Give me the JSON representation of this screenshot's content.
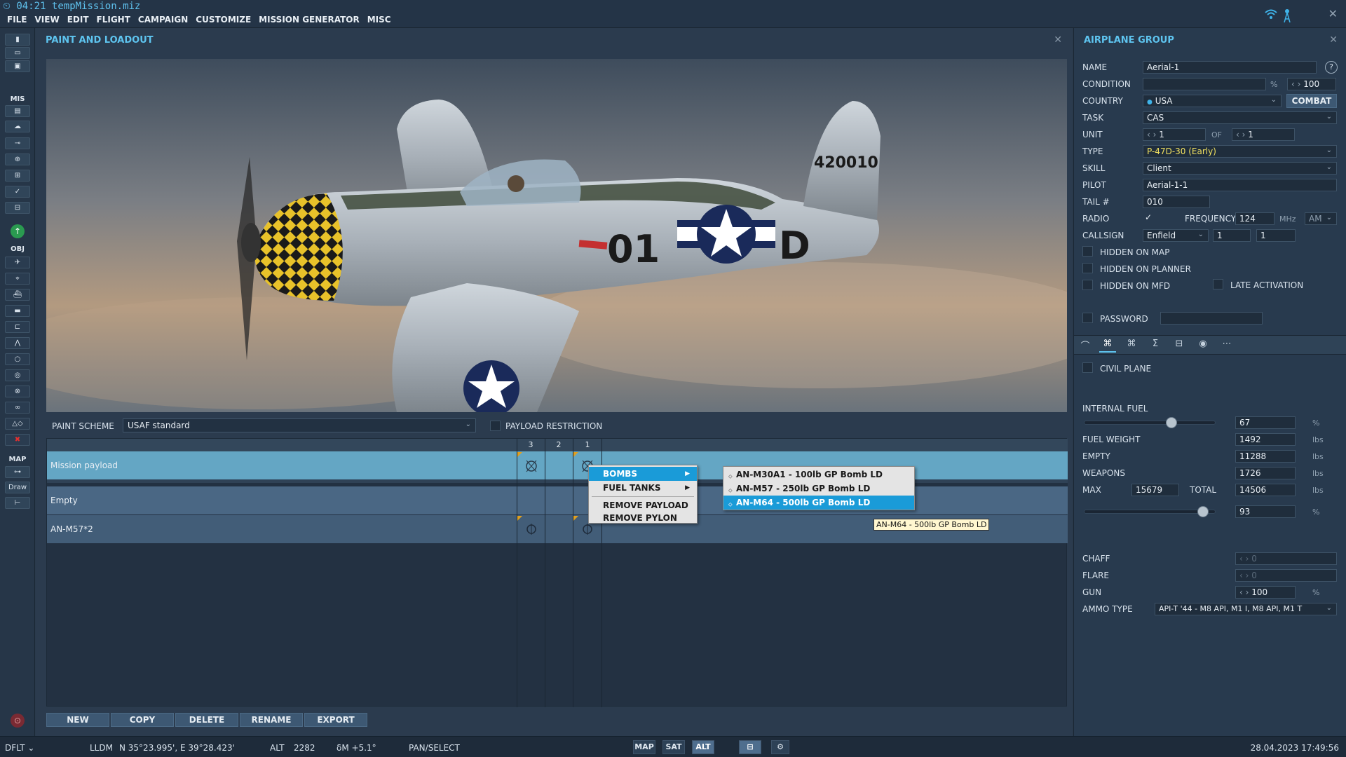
{
  "window": {
    "title": "04:21 tempMission.miz"
  },
  "menu": [
    "FILE",
    "VIEW",
    "EDIT",
    "FLIGHT",
    "CAMPAIGN",
    "CUSTOMIZE",
    "MISSION GENERATOR",
    "MISC"
  ],
  "toolbar": {
    "mis_label": "MIS",
    "obj_label": "OBJ",
    "map_label": "MAP",
    "draw_label": "Draw"
  },
  "paint_panel": {
    "title": "PAINT AND LOADOUT",
    "aircraft_marking": "420010",
    "fuselage_code_left": "01",
    "fuselage_code_right": "D",
    "paint_scheme_label": "PAINT SCHEME",
    "paint_scheme_value": "USAF standard",
    "payload_restriction_label": "PAYLOAD RESTRICTION",
    "pylons": [
      "3",
      "2",
      "1"
    ],
    "rows": [
      {
        "label": "Mission payload"
      },
      {
        "label": "Empty"
      },
      {
        "label": "AN-M57*2"
      }
    ],
    "context_menu": {
      "items": [
        "BOMBS",
        "FUEL TANKS",
        "REMOVE PAYLOAD",
        "REMOVE PYLON"
      ],
      "submenu": [
        "AN-M30A1 - 100lb GP Bomb LD",
        "AN-M57 - 250lb GP Bomb LD",
        "AN-M64 - 500lb GP Bomb LD"
      ],
      "tooltip": "AN-M64 - 500lb GP Bomb LD"
    },
    "buttons": [
      "NEW",
      "COPY",
      "DELETE",
      "RENAME",
      "EXPORT"
    ]
  },
  "group_panel": {
    "title": "AIRPLANE GROUP",
    "help": "?",
    "name_label": "NAME",
    "name_value": "Aerial-1",
    "condition_label": "CONDITION",
    "condition_unit": "%",
    "condition_value": "100",
    "country_label": "COUNTRY",
    "country_value": "USA",
    "combat_label": "COMBAT",
    "task_label": "TASK",
    "task_value": "CAS",
    "unit_label": "UNIT",
    "unit_value": "1",
    "of_label": "OF",
    "unit_total": "1",
    "type_label": "TYPE",
    "type_value": "P-47D-30 (Early)",
    "skill_label": "SKILL",
    "skill_value": "Client",
    "pilot_label": "PILOT",
    "pilot_value": "Aerial-1-1",
    "tail_label": "TAIL #",
    "tail_value": "010",
    "radio_label": "RADIO",
    "frequency_label": "FREQUENCY",
    "frequency_value": "124",
    "frequency_unit": "MHz",
    "modulation": "AM",
    "callsign_label": "CALLSIGN",
    "callsign_value": "Enfield",
    "callsign_n1": "1",
    "callsign_n2": "1",
    "hidden_map_label": "HIDDEN ON MAP",
    "hidden_planner_label": "HIDDEN ON PLANNER",
    "hidden_mfd_label": "HIDDEN ON MFD",
    "late_activation_label": "LATE ACTIVATION",
    "password_label": "PASSWORD",
    "civil_plane_label": "CIVIL PLANE",
    "internal_fuel_label": "INTERNAL FUEL",
    "internal_fuel_value": "67",
    "pct": "%",
    "fuel_weight_label": "FUEL WEIGHT",
    "fuel_weight_value": "1492",
    "lbs": "lbs",
    "empty_label": "EMPTY",
    "empty_value": "11288",
    "weapons_label": "WEAPONS",
    "weapons_value": "1726",
    "max_label": "MAX",
    "max_value": "15679",
    "total_label": "TOTAL",
    "total_value": "14506",
    "load_pct_value": "93",
    "chaff_label": "CHAFF",
    "chaff_value": "0",
    "flare_label": "FLARE",
    "flare_value": "0",
    "gun_label": "GUN",
    "gun_value": "100",
    "ammo_label": "AMMO TYPE",
    "ammo_value": "API-T '44 - M8 API, M1 I, M8 API, M1 T"
  },
  "statusbar": {
    "profile": "DFLT",
    "coord_mode": "LLDM",
    "coords": "N 35°23.995', E 39°28.423'",
    "alt_label": "ALT",
    "alt_value": "2282",
    "magvar": "δM  +5.1°",
    "mode": "PAN/SELECT",
    "btn_map": "MAP",
    "btn_sat": "SAT",
    "btn_alt": "ALT",
    "datetime": "28.04.2023 17:49:56"
  },
  "colors": {
    "accent": "#5ec4ef",
    "selection": "#1a9bd8",
    "type_value": "#f0e060"
  }
}
